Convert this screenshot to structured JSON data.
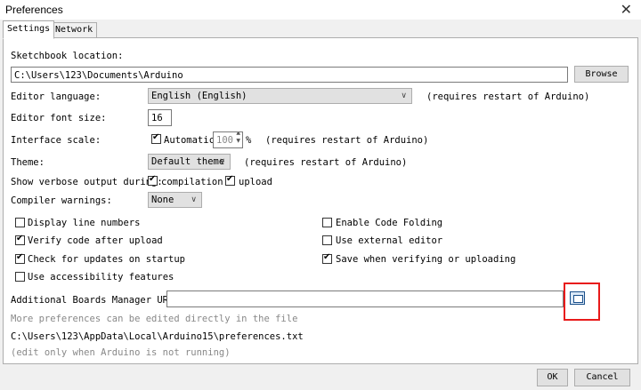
{
  "window": {
    "title": "Preferences",
    "close_glyph": "✕"
  },
  "tabs": [
    {
      "label": "Settings"
    },
    {
      "label": "Network"
    }
  ],
  "sketchbook": {
    "label": "Sketchbook location:",
    "value": "C:\\Users\\123\\Documents\\Arduino",
    "browse": "Browse"
  },
  "language": {
    "label": "Editor language:",
    "value": "English (English)",
    "note": "(requires restart of Arduino)"
  },
  "font_size": {
    "label": "Editor font size:",
    "value": "16"
  },
  "scale": {
    "label": "Interface scale:",
    "auto_label": "Automatic",
    "auto_checked": true,
    "value": "100",
    "unit": "%",
    "note": "(requires restart of Arduino)"
  },
  "theme": {
    "label": "Theme:",
    "value": "Default theme",
    "note": "(requires restart of Arduino)"
  },
  "verbose": {
    "label": "Show verbose output during:",
    "compilation": "compilation",
    "compilation_checked": true,
    "upload": "upload",
    "upload_checked": true
  },
  "warnings": {
    "label": "Compiler warnings:",
    "value": "None"
  },
  "options_left": [
    {
      "label": "Display line numbers",
      "checked": false
    },
    {
      "label": "Verify code after upload",
      "checked": true
    },
    {
      "label": "Check for updates on startup",
      "checked": true
    },
    {
      "label": "Use accessibility features",
      "checked": false
    }
  ],
  "options_right": [
    {
      "label": "Enable Code Folding",
      "checked": false
    },
    {
      "label": "Use external editor",
      "checked": false
    },
    {
      "label": "Save when verifying or uploading",
      "checked": true
    }
  ],
  "boards": {
    "label": "Additional Boards Manager URLs:",
    "value": ""
  },
  "footer": {
    "more": "More preferences can be edited directly in the file",
    "path": "C:\\Users\\123\\AppData\\Local\\Arduino15\\preferences.txt",
    "note": "(edit only when Arduino is not running)"
  },
  "buttons": {
    "ok": "OK",
    "cancel": "Cancel"
  }
}
